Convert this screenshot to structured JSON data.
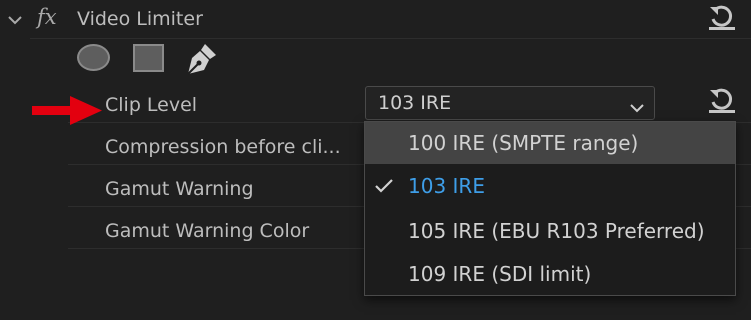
{
  "effect": {
    "title": "Video Limiter",
    "fx_label": "fx"
  },
  "rows": {
    "clip_level": "Clip Level",
    "compression": "Compression before cli...",
    "gamut_warning": "Gamut Warning",
    "gamut_warning_color": "Gamut Warning Color"
  },
  "select": {
    "value": "103 IRE",
    "options": [
      "100 IRE (SMPTE range)",
      "103 IRE",
      "105 IRE (EBU R103 Preferred)",
      "109 IRE (SDI limit)"
    ],
    "hovered_index": 0,
    "selected_index": 1
  },
  "colors": {
    "background": "#1f1f1f",
    "selected_text": "#3e9ee8",
    "hover_bg": "#444444",
    "annotation_arrow": "#e3000f"
  },
  "icons": [
    "chevron-down-icon",
    "reset-icon",
    "ellipse-mask-icon",
    "rectangle-mask-icon",
    "pen-mask-icon",
    "checkmark-icon",
    "red-arrow-annotation"
  ]
}
